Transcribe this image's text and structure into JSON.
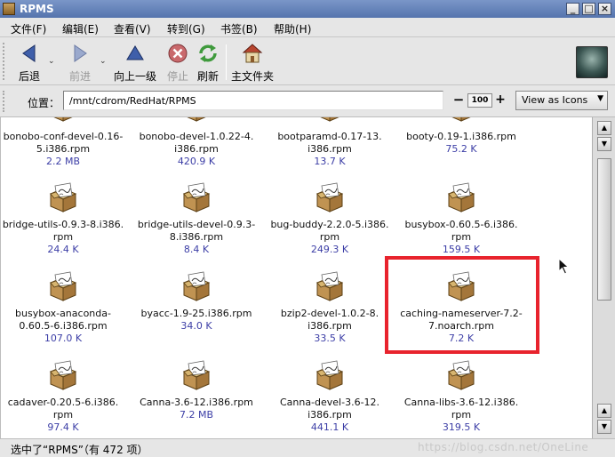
{
  "window": {
    "title": "RPMS"
  },
  "menu": [
    "文件(F)",
    "编辑(E)",
    "查看(V)",
    "转到(G)",
    "书签(B)",
    "帮助(H)"
  ],
  "toolbar": {
    "back": "后退",
    "forward": "前进",
    "up": "向上一级",
    "stop": "停止",
    "reload": "刷新",
    "home": "主文件夹"
  },
  "location": {
    "label": "位置：",
    "path": "/mnt/cdrom/RedHat/RPMS",
    "zoom": "100",
    "zoom_minus": "−",
    "zoom_plus": "+",
    "view_mode": "View as Icons"
  },
  "files": [
    {
      "name1": "bonobo-conf-devel-0.16-",
      "name2": "5.i386.rpm",
      "size": "2.2 MB"
    },
    {
      "name1": "bonobo-devel-1.0.22-4.",
      "name2": "i386.rpm",
      "size": "420.9 K"
    },
    {
      "name1": "bootparamd-0.17-13.",
      "name2": "i386.rpm",
      "size": "13.7 K"
    },
    {
      "name1": "booty-0.19-1.i386.rpm",
      "name2": "",
      "size": "75.2 K"
    },
    {
      "name1": "bridge-utils-0.9.3-8.i386.",
      "name2": "rpm",
      "size": "24.4 K"
    },
    {
      "name1": "bridge-utils-devel-0.9.3-",
      "name2": "8.i386.rpm",
      "size": "8.4 K"
    },
    {
      "name1": "bug-buddy-2.2.0-5.i386.",
      "name2": "rpm",
      "size": "249.3 K"
    },
    {
      "name1": "busybox-0.60.5-6.i386.",
      "name2": "rpm",
      "size": "159.5 K"
    },
    {
      "name1": "busybox-anaconda-",
      "name2": "0.60.5-6.i386.rpm",
      "size": "107.0 K"
    },
    {
      "name1": "byacc-1.9-25.i386.rpm",
      "name2": "",
      "size": "34.0 K"
    },
    {
      "name1": "bzip2-devel-1.0.2-8.",
      "name2": "i386.rpm",
      "size": "33.5 K"
    },
    {
      "name1": "caching-nameserver-7.2-",
      "name2": "7.noarch.rpm",
      "size": "7.2 K"
    },
    {
      "name1": "cadaver-0.20.5-6.i386.",
      "name2": "rpm",
      "size": "97.4 K"
    },
    {
      "name1": "Canna-3.6-12.i386.rpm",
      "name2": "",
      "size": "7.2 MB"
    },
    {
      "name1": "Canna-devel-3.6-12.",
      "name2": "i386.rpm",
      "size": "441.1 K"
    },
    {
      "name1": "Canna-libs-3.6-12.i386.",
      "name2": "rpm",
      "size": "319.5 K"
    }
  ],
  "status": {
    "text": "选中了“RPMS”（有 472 项）"
  },
  "watermark": "https://blog.csdn.net/OneLine",
  "colors": {
    "titlebar": "#5b79b2",
    "size_text": "#3c3ea6",
    "highlight": "#e8232d"
  }
}
